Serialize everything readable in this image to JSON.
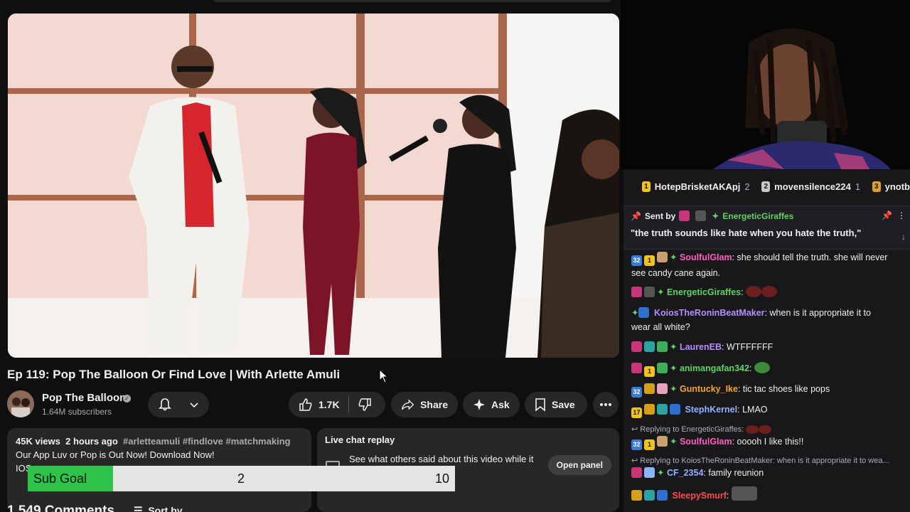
{
  "video": {
    "title": "Ep 119: Pop The Balloon Or Find Love | With Arlette Amuli"
  },
  "channel": {
    "name": "Pop The Balloon",
    "subscribers": "1.64M subscribers"
  },
  "actions": {
    "likes": "1.7K",
    "share": "Share",
    "ask": "Ask",
    "save": "Save"
  },
  "description": {
    "views": "45K views",
    "age": "2 hours ago",
    "tags": "#arletteamuli #findlove #matchmaking",
    "line1": "Our App Luv or Pop is Out Now! Download Now!",
    "line2": "IOS"
  },
  "live_chat": {
    "title": "Live chat replay",
    "subtitle": "See what others said about this video while it",
    "open_panel": "Open panel"
  },
  "sub_goal": {
    "label": "Sub Goal",
    "current": "2",
    "target": "10",
    "progress_fraction": 0.2
  },
  "comments": {
    "count_label": "1,549 Comments",
    "sort_label": "Sort by"
  },
  "chat": {
    "leaderboard": [
      {
        "rank": "1",
        "name": "HotepBrisketAKApj",
        "count": "2",
        "color": "#f0c419"
      },
      {
        "rank": "2",
        "name": "movensilence224",
        "count": "1",
        "color": "#c8c8c8"
      },
      {
        "rank": "3",
        "name": "ynotb",
        "count": "",
        "color": "#e0a030"
      }
    ],
    "pinned": {
      "sent_by_label": "Sent by",
      "user": "EnergeticGiraffes",
      "text": "\"the truth sounds like hate when you hate the truth,\""
    },
    "messages": [
      {
        "user": "SoulfulGlam",
        "color": "#ff5ec6",
        "text": " she should tell the truth. she will never see candy cane again.",
        "line2": ""
      },
      {
        "user": "EnergeticGiraffes",
        "color": "#5fd35f",
        "text": "",
        "line2": ""
      },
      {
        "user": "KoiosTheRoninBeatMaker",
        "color": "#b78cff",
        "text": " when is it appropriate it to",
        "line2": "wear all white?"
      },
      {
        "user": "LaurenEB",
        "color": "#b78cff",
        "text": " WTFFFFFF",
        "line2": ""
      },
      {
        "user": "animangafan342",
        "color": "#5fd35f",
        "text": "",
        "line2": ""
      },
      {
        "user": "Guntucky_Ike",
        "color": "#f5a623",
        "text": " tic tac shoes like pops",
        "line2": ""
      },
      {
        "user": "StephKernel",
        "color": "#8ab4ff",
        "text": " LMAO",
        "line2": ""
      },
      {
        "user": "SoulfulGlam",
        "color": "#ff5ec6",
        "text": " ooooh I like this!!",
        "line2": ""
      },
      {
        "user": "CF_2354",
        "color": "#8ab4ff",
        "text": " family reunion",
        "line2": ""
      },
      {
        "user": "SleepySmurf",
        "color": "#ff4a4a",
        "text": "",
        "line2": ""
      }
    ],
    "replies": [
      "Replying to EnergeticGiraffes:",
      "Replying to KoiosTheRoninBeatMaker: when is it appropriate it to wea..."
    ]
  }
}
